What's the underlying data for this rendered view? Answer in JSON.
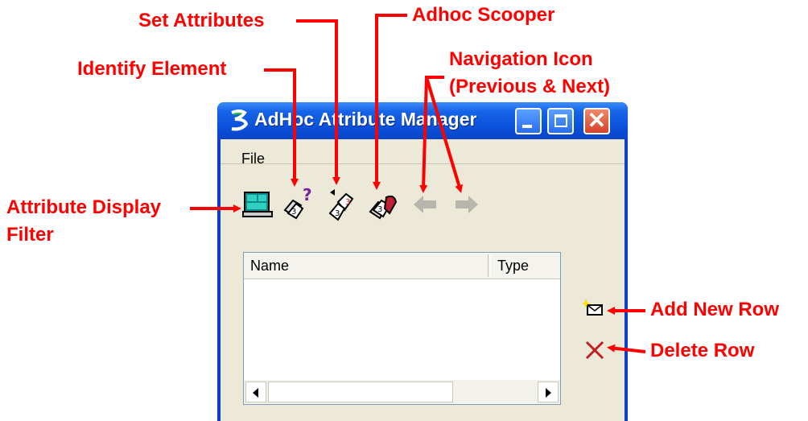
{
  "window": {
    "title": "AdHoc Attribute Manager",
    "menu": [
      "File"
    ],
    "toolbar": [
      {
        "name": "attribute-display-filter-icon"
      },
      {
        "name": "identify-element-icon"
      },
      {
        "name": "set-attributes-icon"
      },
      {
        "name": "adhoc-scooper-icon"
      },
      {
        "name": "previous-arrow-icon"
      },
      {
        "name": "next-arrow-icon"
      }
    ],
    "list": {
      "columns": [
        "Name",
        "Type"
      ]
    }
  },
  "annotations": {
    "set_attributes": "Set Attributes",
    "adhoc_scooper": "Adhoc Scooper",
    "identify_element": "Identify Element",
    "navigation_line1": "Navigation Icon",
    "navigation_line2": "(Previous & Next)",
    "attribute_display_line1": "Attribute Display",
    "attribute_display_line2": "Filter",
    "add_new_row": "Add New Row",
    "delete_row": "Delete Row"
  },
  "colors": {
    "annotation": "#ff0000",
    "titlebar": "#0a4fd8",
    "client": "#ece9d8"
  }
}
